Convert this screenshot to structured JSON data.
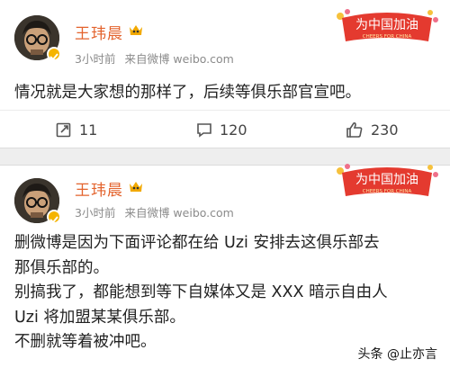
{
  "posts": [
    {
      "author": "王玮晨",
      "time": "3小时前",
      "source": "来自微博 weibo.com",
      "banner_text": "为中国加油",
      "banner_sub": "CHEERS FOR CHINA",
      "lines": [
        "情况就是大家想的那样了，后续等俱乐部官宣吧。"
      ],
      "repost_count": "11",
      "comment_count": "120",
      "like_count": "230"
    },
    {
      "author": "王玮晨",
      "time": "3小时前",
      "source": "来自微博 weibo.com",
      "banner_text": "为中国加油",
      "banner_sub": "CHEERS FOR CHINA",
      "lines": [
        "删微博是因为下面评论都在给 Uzi 安排去这俱乐部去",
        "那俱乐部的。",
        "别搞我了，都能想到等下自媒体又是 XXX 暗示自由人",
        "Uzi 将加盟某某俱乐部。",
        "不删就等着被冲吧。"
      ]
    }
  ],
  "watermark": "头条 @止亦言",
  "colors": {
    "author_name": "#e3632d",
    "meta_gray": "#8b8b8b",
    "banner_red": "#e43a2f"
  }
}
